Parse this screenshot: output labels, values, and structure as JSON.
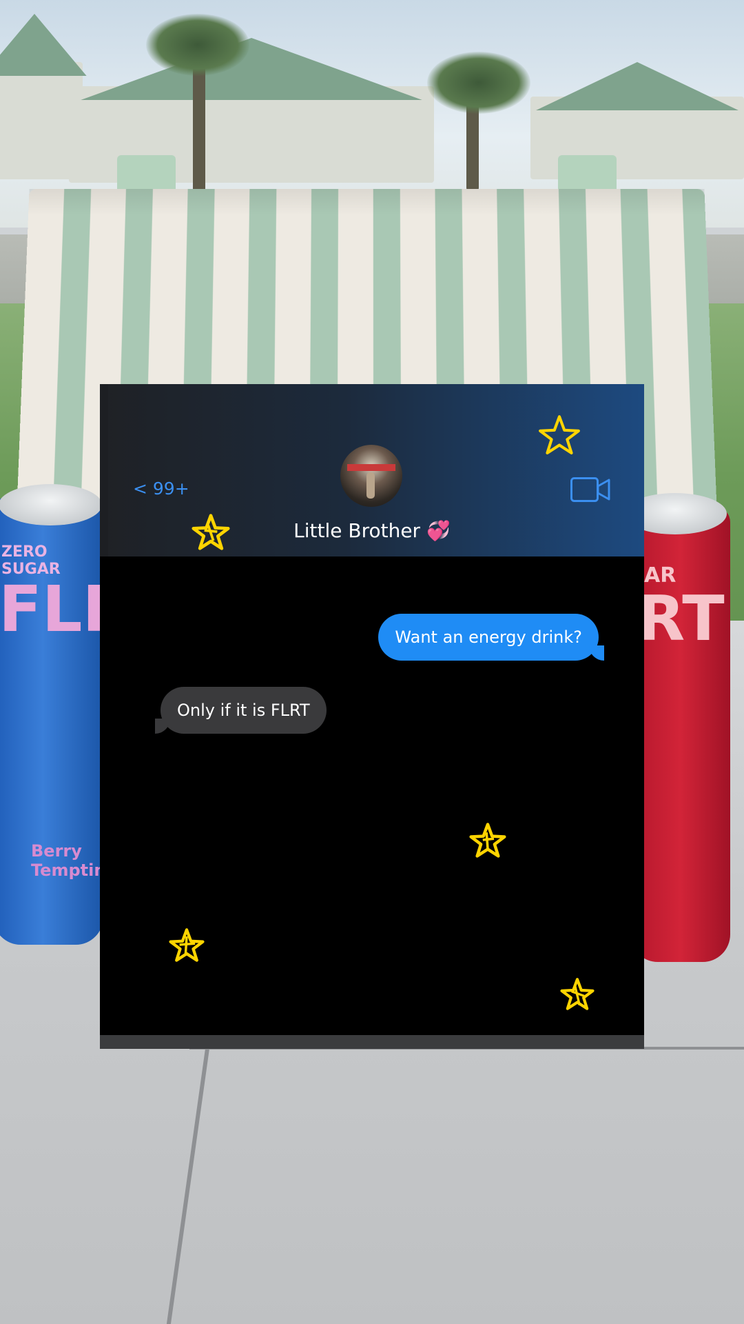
{
  "chat": {
    "back_label": "< 99+",
    "contact_name": "Little Brother",
    "contact_emoji": "💞",
    "video_icon": "video-camera-icon",
    "messages": [
      {
        "direction": "sent",
        "text": "Want an energy drink?"
      },
      {
        "direction": "received",
        "text": "Only if it is FLRT"
      }
    ]
  },
  "background": {
    "can_left_text": "ZERO SUGAR",
    "can_left_brand": "FLRT",
    "can_left_flavor": "Berry Tempting",
    "can_right_text": "AR",
    "can_right_brand": "RT"
  },
  "decorations": {
    "star_icon": "hand-drawn-star-icon",
    "star_color": "#ffd400"
  },
  "colors": {
    "accent": "#1f8cf5",
    "received_bubble": "#3a3a3c"
  }
}
